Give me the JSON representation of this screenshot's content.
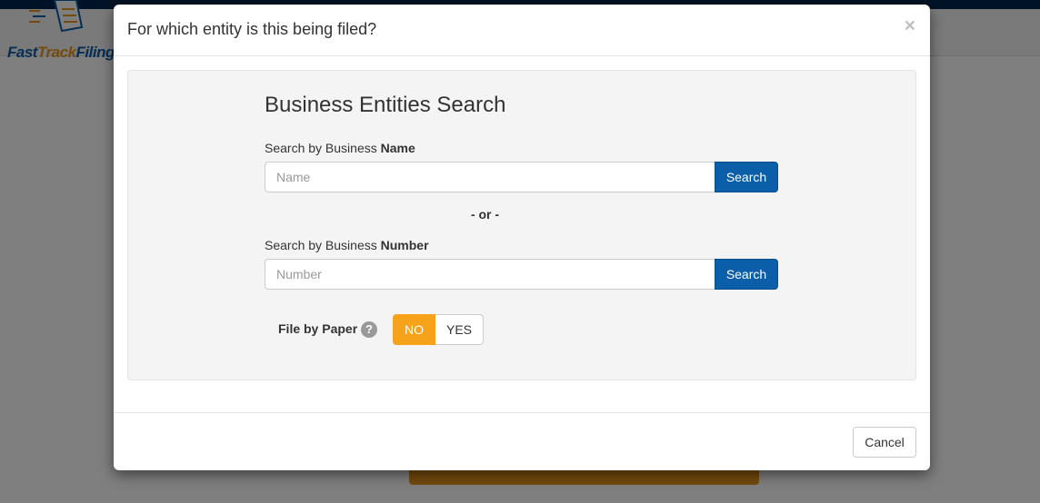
{
  "app": {
    "logo": {
      "part1": "Fast",
      "part2": "Track",
      "part3": "Filing"
    },
    "brand_colors": {
      "blue": "#0b5ea8",
      "orange": "#e8961f",
      "navy": "#00264d"
    }
  },
  "modal": {
    "title": "For which entity is this being filed?",
    "close_label": "×",
    "heading": "Business Entities Search",
    "name_search": {
      "label_prefix": "Search by Business ",
      "label_bold": "Name",
      "placeholder": "Name",
      "value": "",
      "button_label": "Search"
    },
    "or_text": "- or -",
    "number_search": {
      "label_prefix": "Search by Business ",
      "label_bold": "Number",
      "placeholder": "Number",
      "value": "",
      "button_label": "Search"
    },
    "file_by_paper": {
      "label": "File by Paper",
      "help_icon": "?",
      "options": [
        "NO",
        "YES"
      ],
      "selected": "NO"
    },
    "cancel_label": "Cancel"
  }
}
